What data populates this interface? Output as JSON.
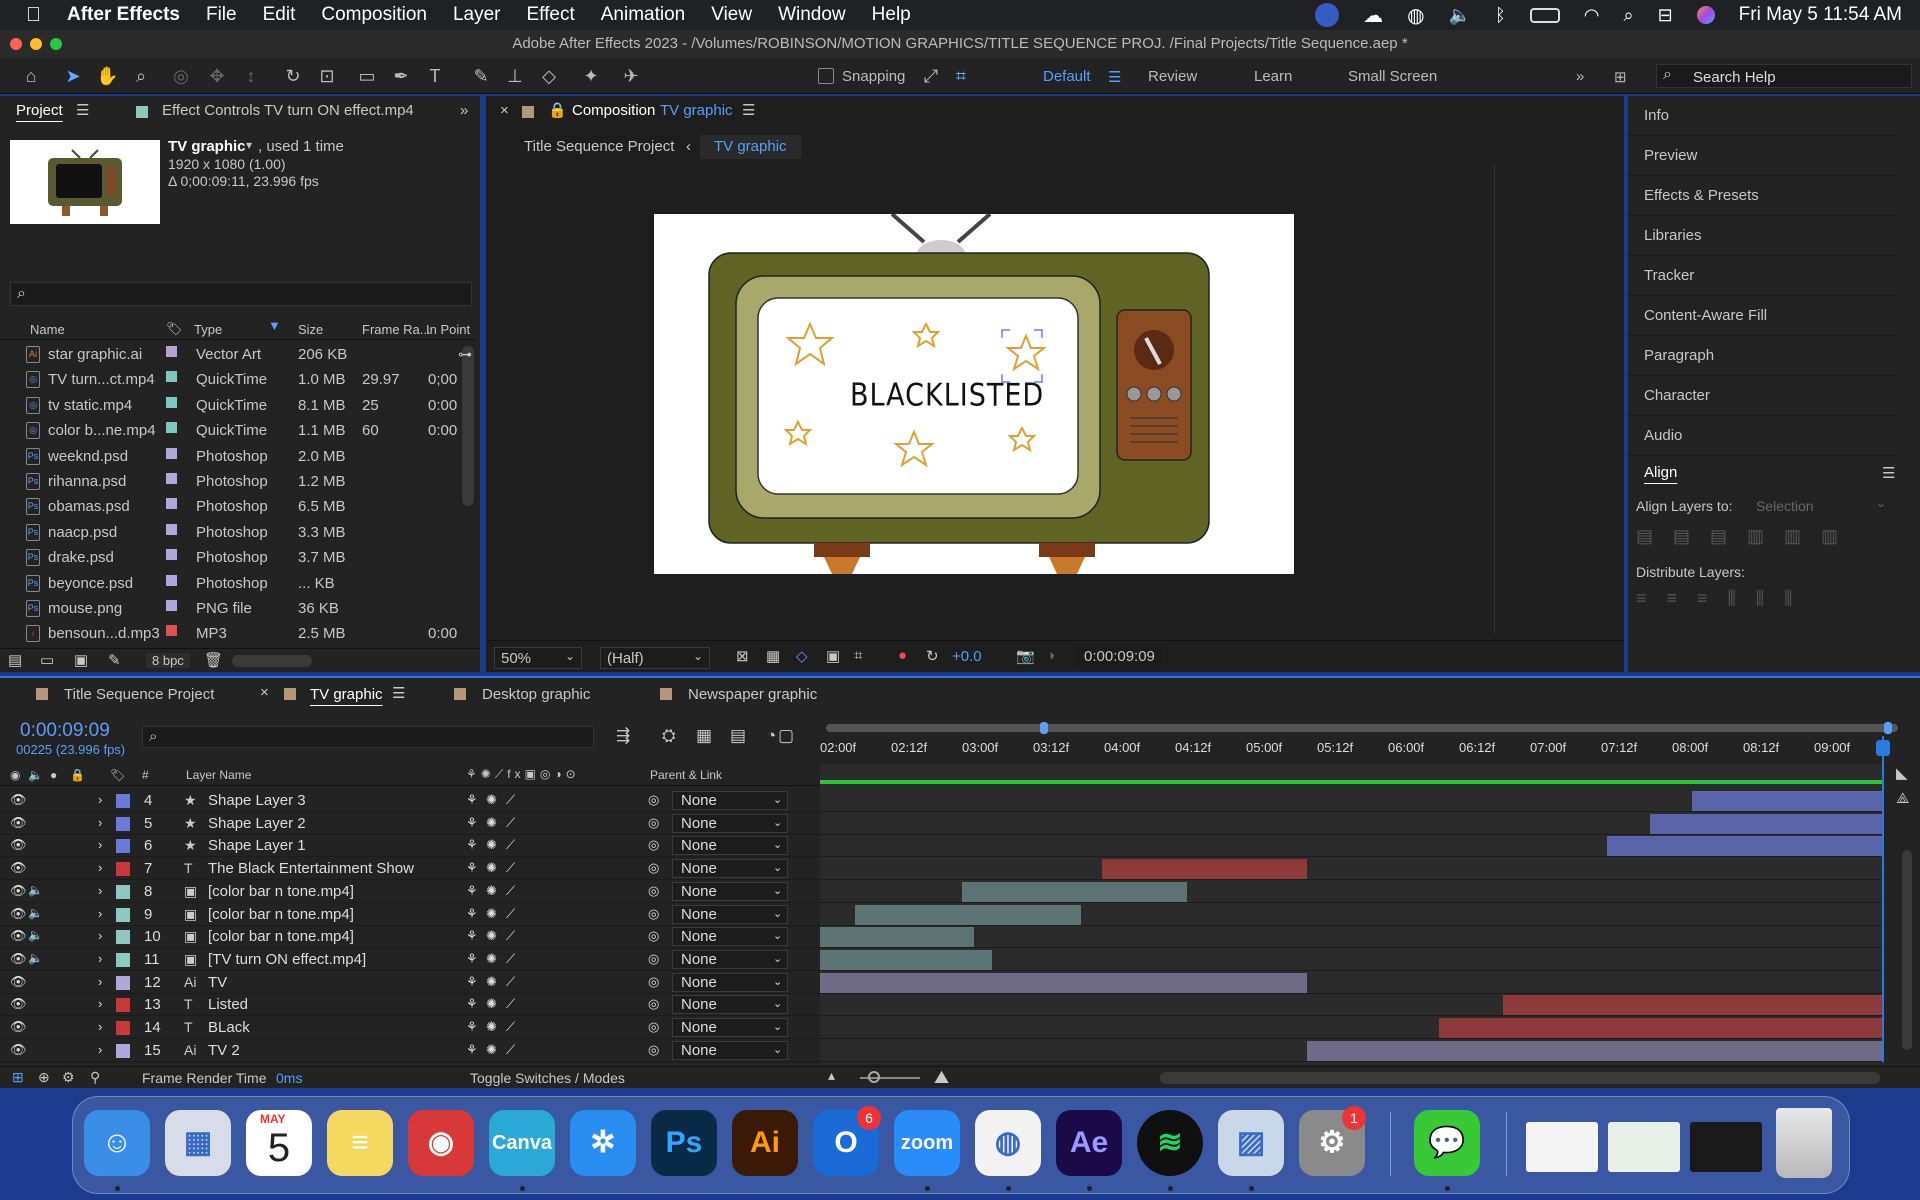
{
  "menubar": {
    "app": "After Effects",
    "items": [
      "File",
      "Edit",
      "Composition",
      "Layer",
      "Effect",
      "Animation",
      "View",
      "Window",
      "Help"
    ],
    "clock": "Fri May 5  11:54 AM"
  },
  "titlebar": {
    "title": "Adobe After Effects 2023 - /Volumes/ROBINSON/MOTION GRAPHICS/TITLE SEQUENCE PROJ. /Final Projects/Title Sequence.aep *"
  },
  "toolbar": {
    "snapping": "Snapping",
    "workspaces": [
      "Default",
      "Review",
      "Learn",
      "Small Screen"
    ],
    "search_help": "Search Help"
  },
  "project": {
    "tab": "Project",
    "effect_tab": "Effect Controls TV turn ON effect.mp4",
    "item_name": "TV graphic",
    "item_used": ", used 1 time",
    "item_size": "1920 x 1080 (1.00)",
    "item_duration": "Δ 0;00:09:11, 23.996 fps",
    "columns": [
      "Name",
      "Type",
      "Size",
      "Frame Ra...",
      "In Point"
    ],
    "rows": [
      {
        "name": "star graphic.ai",
        "type": "Vector Art",
        "size": "206 KB",
        "fps": "",
        "in": "",
        "icon": "Ai",
        "color": "#b8a0d0"
      },
      {
        "name": "TV turn...ct.mp4",
        "type": "QuickTime",
        "size": "1.0 MB",
        "fps": "29.97",
        "in": "0;00",
        "icon": "◎",
        "color": "#7fc8c0"
      },
      {
        "name": "tv static.mp4",
        "type": "QuickTime",
        "size": "8.1 MB",
        "fps": "25",
        "in": "0:00",
        "icon": "◎",
        "color": "#7fc8c0"
      },
      {
        "name": "color b...ne.mp4",
        "type": "QuickTime",
        "size": "1.1 MB",
        "fps": "60",
        "in": "0:00",
        "icon": "◎",
        "color": "#7fc8c0"
      },
      {
        "name": "weeknd.psd",
        "type": "Photoshop",
        "size": "2.0 MB",
        "fps": "",
        "in": "",
        "icon": "Ps",
        "color": "#b0a8d8"
      },
      {
        "name": "rihanna.psd",
        "type": "Photoshop",
        "size": "1.2 MB",
        "fps": "",
        "in": "",
        "icon": "Ps",
        "color": "#b0a8d8"
      },
      {
        "name": "obamas.psd",
        "type": "Photoshop",
        "size": "6.5 MB",
        "fps": "",
        "in": "",
        "icon": "Ps",
        "color": "#b0a8d8"
      },
      {
        "name": "naacp.psd",
        "type": "Photoshop",
        "size": "3.3 MB",
        "fps": "",
        "in": "",
        "icon": "Ps",
        "color": "#b0a8d8"
      },
      {
        "name": "drake.psd",
        "type": "Photoshop",
        "size": "3.7 MB",
        "fps": "",
        "in": "",
        "icon": "Ps",
        "color": "#b0a8d8"
      },
      {
        "name": "beyonce.psd",
        "type": "Photoshop",
        "size": "... KB",
        "fps": "",
        "in": "",
        "icon": "Ps",
        "color": "#b0a8d8"
      },
      {
        "name": "mouse.png",
        "type": "PNG file",
        "size": "36 KB",
        "fps": "",
        "in": "",
        "icon": "Ps",
        "color": "#b0a8d8"
      },
      {
        "name": "bensoun...d.mp3",
        "type": "MP3",
        "size": "2.5 MB",
        "fps": "",
        "in": "0:00",
        "icon": "♪",
        "color": "#e05050"
      }
    ],
    "bpc": "8 bpc"
  },
  "composition": {
    "tab_label": "Composition",
    "tab_name": "TV graphic",
    "breadcrumb": [
      "Title Sequence Project",
      "TV graphic"
    ],
    "screen_text": "BLACKLISTED",
    "zoom": "50%",
    "resolution": "(Half)",
    "exposure": "+0.0",
    "timecode": "0:00:09:09"
  },
  "right_panel": {
    "items": [
      "Info",
      "Preview",
      "Effects & Presets",
      "Libraries",
      "Tracker",
      "Content-Aware Fill",
      "Paragraph",
      "Character",
      "Audio"
    ],
    "align_title": "Align",
    "align_to_label": "Align Layers to:",
    "align_to_value": "Selection",
    "distribute_label": "Distribute Layers:"
  },
  "timeline": {
    "tabs": [
      "Title Sequence Project",
      "TV graphic",
      "Desktop graphic",
      "Newspaper graphic"
    ],
    "timecode": "0:00:09:09",
    "frames": "00225 (23.996 fps)",
    "col_hash": "#",
    "col_layer": "Layer Name",
    "col_parent": "Parent & Link",
    "ruler": [
      "02:00f",
      "02:12f",
      "03:00f",
      "03:12f",
      "04:00f",
      "04:12f",
      "05:00f",
      "05:12f",
      "06:00f",
      "06:12f",
      "07:00f",
      "07:12f",
      "08:00f",
      "08:12f",
      "09:00f"
    ],
    "layers": [
      {
        "num": "4",
        "name": "Shape Layer 3",
        "kind": "★",
        "label": "#6a7ad8",
        "parent": "None",
        "bar_start": 0.82,
        "bar_end": 1.0,
        "bar_color": "#5a64a8"
      },
      {
        "num": "5",
        "name": "Shape Layer 2",
        "kind": "★",
        "label": "#6a7ad8",
        "parent": "None",
        "bar_start": 0.78,
        "bar_end": 1.0,
        "bar_color": "#5a64a8"
      },
      {
        "num": "6",
        "name": "Shape Layer 1",
        "kind": "★",
        "label": "#6a7ad8",
        "parent": "None",
        "bar_start": 0.74,
        "bar_end": 1.0,
        "bar_color": "#5a64a8"
      },
      {
        "num": "7",
        "name": "The Black Entertainment Show",
        "kind": "T",
        "label": "#c83a3a",
        "parent": "None",
        "bar_start": 0.265,
        "bar_end": 0.458,
        "bar_color": "#8e3a3a"
      },
      {
        "num": "8",
        "name": "[color bar n tone.mp4]",
        "kind": "▣",
        "label": "#8ec8c0",
        "parent": "None",
        "bar_start": 0.133,
        "bar_end": 0.345,
        "bar_color": "#5e7474"
      },
      {
        "num": "9",
        "name": "[color bar n tone.mp4]",
        "kind": "▣",
        "label": "#8ec8c0",
        "parent": "None",
        "bar_start": 0.033,
        "bar_end": 0.245,
        "bar_color": "#5e7474"
      },
      {
        "num": "10",
        "name": "[color bar n tone.mp4]",
        "kind": "▣",
        "label": "#8ec8c0",
        "parent": "None",
        "bar_start": 0.0,
        "bar_end": 0.145,
        "bar_color": "#5e7474"
      },
      {
        "num": "11",
        "name": "[TV turn ON effect.mp4]",
        "kind": "▣",
        "label": "#8ec8c0",
        "parent": "None",
        "bar_start": 0.0,
        "bar_end": 0.162,
        "bar_color": "#5e7474"
      },
      {
        "num": "12",
        "name": "TV",
        "kind": "Ai",
        "label": "#b0a8d8",
        "parent": "None",
        "bar_start": 0.0,
        "bar_end": 0.458,
        "bar_color": "#6e6a88"
      },
      {
        "num": "13",
        "name": "Listed",
        "kind": "T",
        "label": "#c83a3a",
        "parent": "None",
        "bar_start": 0.642,
        "bar_end": 1.0,
        "bar_color": "#8e3a3a"
      },
      {
        "num": "14",
        "name": "BLack",
        "kind": "T",
        "label": "#c83a3a",
        "parent": "None",
        "bar_start": 0.582,
        "bar_end": 1.0,
        "bar_color": "#8e3a3a"
      },
      {
        "num": "15",
        "name": "TV 2",
        "kind": "Ai",
        "label": "#b0a8d8",
        "parent": "None",
        "bar_start": 0.458,
        "bar_end": 1.0,
        "bar_color": "#6e6a88"
      }
    ],
    "render_label": "Frame Render Time",
    "render_value": "0ms",
    "toggle": "Toggle Switches / Modes"
  },
  "dock": {
    "apps": [
      {
        "name": "Finder",
        "glyph": "☺",
        "bg": "#3a8ee8"
      },
      {
        "name": "Launchpad",
        "glyph": "▦",
        "bg": "#d8dce8"
      },
      {
        "name": "Calendar",
        "glyph": "5",
        "bg": "#ffffff"
      },
      {
        "name": "Notes",
        "glyph": "≡",
        "bg": "#f4d860"
      },
      {
        "name": "Photo Booth",
        "glyph": "◉",
        "bg": "#d83838"
      },
      {
        "name": "Canva",
        "glyph": "Canva",
        "bg": "#2aa8d8"
      },
      {
        "name": "Safari",
        "glyph": "✲",
        "bg": "#2a8ef0"
      },
      {
        "name": "Photoshop",
        "glyph": "Ps",
        "bg": "#0a2a48"
      },
      {
        "name": "Illustrator",
        "glyph": "Ai",
        "bg": "#3a1a04"
      },
      {
        "name": "Outlook",
        "glyph": "O",
        "bg": "#1a6ad8"
      },
      {
        "name": "Zoom",
        "glyph": "zoom",
        "bg": "#2a8cf8"
      },
      {
        "name": "Chrome",
        "glyph": "◍",
        "bg": "#f2f2f2"
      },
      {
        "name": "After Effects",
        "glyph": "Ae",
        "bg": "#1a0a48"
      },
      {
        "name": "Spotify",
        "glyph": "≋",
        "bg": "#101010"
      },
      {
        "name": "Preview",
        "glyph": "▨",
        "bg": "#c8d8e8"
      },
      {
        "name": "System Settings",
        "glyph": "⚙",
        "bg": "#8a8a8a"
      },
      {
        "name": "Messages",
        "glyph": "💬",
        "bg": "#38c838"
      }
    ],
    "calendar_month": "MAY",
    "outlook_badge": "6",
    "settings_badge": "1"
  }
}
